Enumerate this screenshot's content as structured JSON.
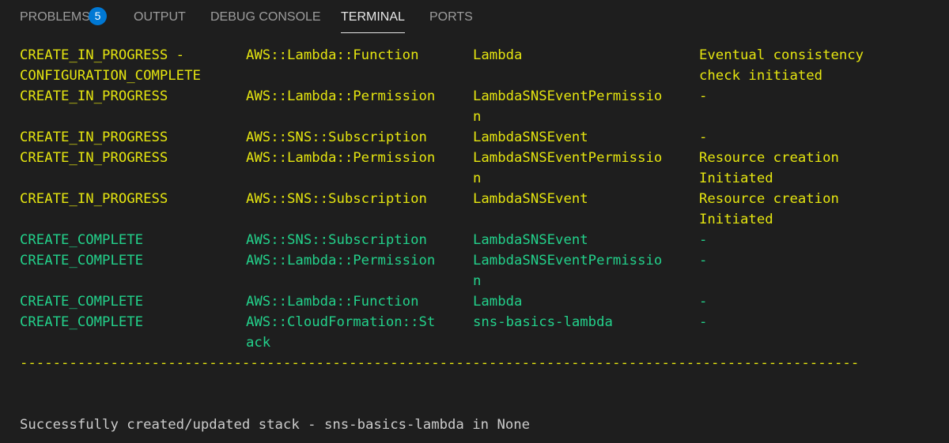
{
  "tabs": [
    {
      "label": "PROBLEMS",
      "badge": "5"
    },
    {
      "label": "OUTPUT"
    },
    {
      "label": "DEBUG CONSOLE"
    },
    {
      "label": "TERMINAL"
    },
    {
      "label": "PORTS"
    }
  ],
  "active_tab": "TERMINAL",
  "colors": {
    "in_progress": "#e5e510",
    "complete": "#23d18b",
    "badge": "#0078d4"
  },
  "rows": [
    {
      "status": "in_progress",
      "c0": "CREATE_IN_PROGRESS -\nCONFIGURATION_COMPLETE",
      "c1": "AWS::Lambda::Function",
      "c2": "Lambda",
      "c3": "Eventual consistency\ncheck initiated"
    },
    {
      "status": "in_progress",
      "c0": "CREATE_IN_PROGRESS",
      "c1": "AWS::Lambda::Permission",
      "c2": "LambdaSNSEventPermissio\nn",
      "c3": "-"
    },
    {
      "status": "in_progress",
      "c0": "CREATE_IN_PROGRESS",
      "c1": "AWS::SNS::Subscription",
      "c2": "LambdaSNSEvent",
      "c3": "-"
    },
    {
      "status": "in_progress",
      "c0": "CREATE_IN_PROGRESS",
      "c1": "AWS::Lambda::Permission",
      "c2": "LambdaSNSEventPermissio\nn",
      "c3": "Resource creation\nInitiated"
    },
    {
      "status": "in_progress",
      "c0": "CREATE_IN_PROGRESS",
      "c1": "AWS::SNS::Subscription",
      "c2": "LambdaSNSEvent",
      "c3": "Resource creation\nInitiated"
    },
    {
      "status": "complete",
      "c0": "CREATE_COMPLETE",
      "c1": "AWS::SNS::Subscription",
      "c2": "LambdaSNSEvent",
      "c3": "-"
    },
    {
      "status": "complete",
      "c0": "CREATE_COMPLETE",
      "c1": "AWS::Lambda::Permission",
      "c2": "LambdaSNSEventPermissio\nn",
      "c3": "-"
    },
    {
      "status": "complete",
      "c0": "CREATE_COMPLETE",
      "c1": "AWS::Lambda::Function",
      "c2": "Lambda",
      "c3": "-"
    },
    {
      "status": "complete",
      "c0": "CREATE_COMPLETE",
      "c1": "AWS::CloudFormation::St\nack",
      "c2": "sns-basics-lambda",
      "c3": "-"
    }
  ],
  "separator": "------------------------------------------------------------------------------------------------------",
  "success_message": "Successfully created/updated stack - sns-basics-lambda in None"
}
